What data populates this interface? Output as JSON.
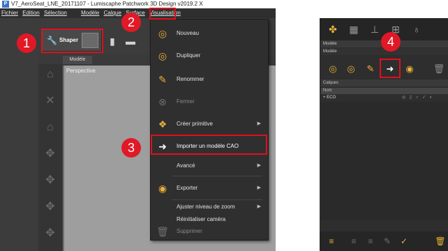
{
  "window": {
    "title": "V7_AeroSeat_LNE_20171107 - Lumiscaphe Patchwork 3D Design v2019.2 X",
    "app_icon": "P"
  },
  "menubar": {
    "items": [
      "Fichier",
      "Edition",
      "Sélection",
      "Modèle",
      "Calque",
      "Surface",
      "Visualisation"
    ]
  },
  "toolbar": {
    "shaper_label": "Shaper"
  },
  "tabs": {
    "model_tab": "Modèle"
  },
  "viewport": {
    "label": "Perspective"
  },
  "menu": {
    "items": [
      {
        "label": "Nouveau",
        "icon": "new-model-icon",
        "enabled": true,
        "submenu": false
      },
      {
        "label": "Dupliquer",
        "icon": "duplicate-icon",
        "enabled": true,
        "submenu": false
      },
      {
        "label": "Renommer",
        "icon": "rename-icon",
        "enabled": true,
        "submenu": false
      },
      {
        "label": "Fermer",
        "icon": "close-icon",
        "enabled": false,
        "submenu": false
      },
      {
        "label": "Créer primitive",
        "icon": "primitive-icon",
        "enabled": true,
        "submenu": true
      },
      {
        "label": "Importer un modèle CAO",
        "icon": "import-cad-icon",
        "enabled": true,
        "submenu": false
      },
      {
        "label": "Avancé",
        "icon": "",
        "enabled": true,
        "submenu": true
      },
      {
        "label": "Exporter",
        "icon": "export-icon",
        "enabled": true,
        "submenu": true
      },
      {
        "label": "Ajuster niveau de zoom",
        "icon": "",
        "enabled": true,
        "submenu": true
      },
      {
        "label": "Réinitialiser caméra",
        "icon": "",
        "enabled": true,
        "submenu": false
      },
      {
        "label": "Supprimer",
        "icon": "delete-icon",
        "enabled": false,
        "submenu": false
      }
    ]
  },
  "right_panel": {
    "model_label_1": "Modèle",
    "model_label_2": "Modèle",
    "layers_label": "Calques",
    "column_name": "Nom",
    "layer_row": "+ ECO",
    "layer_flags": "◎ ▯ ○ ✓ ◐"
  },
  "annotations": {
    "step1": "1",
    "step2": "2",
    "step3": "3",
    "step4": "4"
  },
  "colors": {
    "accent": "#e7b03a",
    "highlight": "#e0101e",
    "badge": "#e11927"
  }
}
